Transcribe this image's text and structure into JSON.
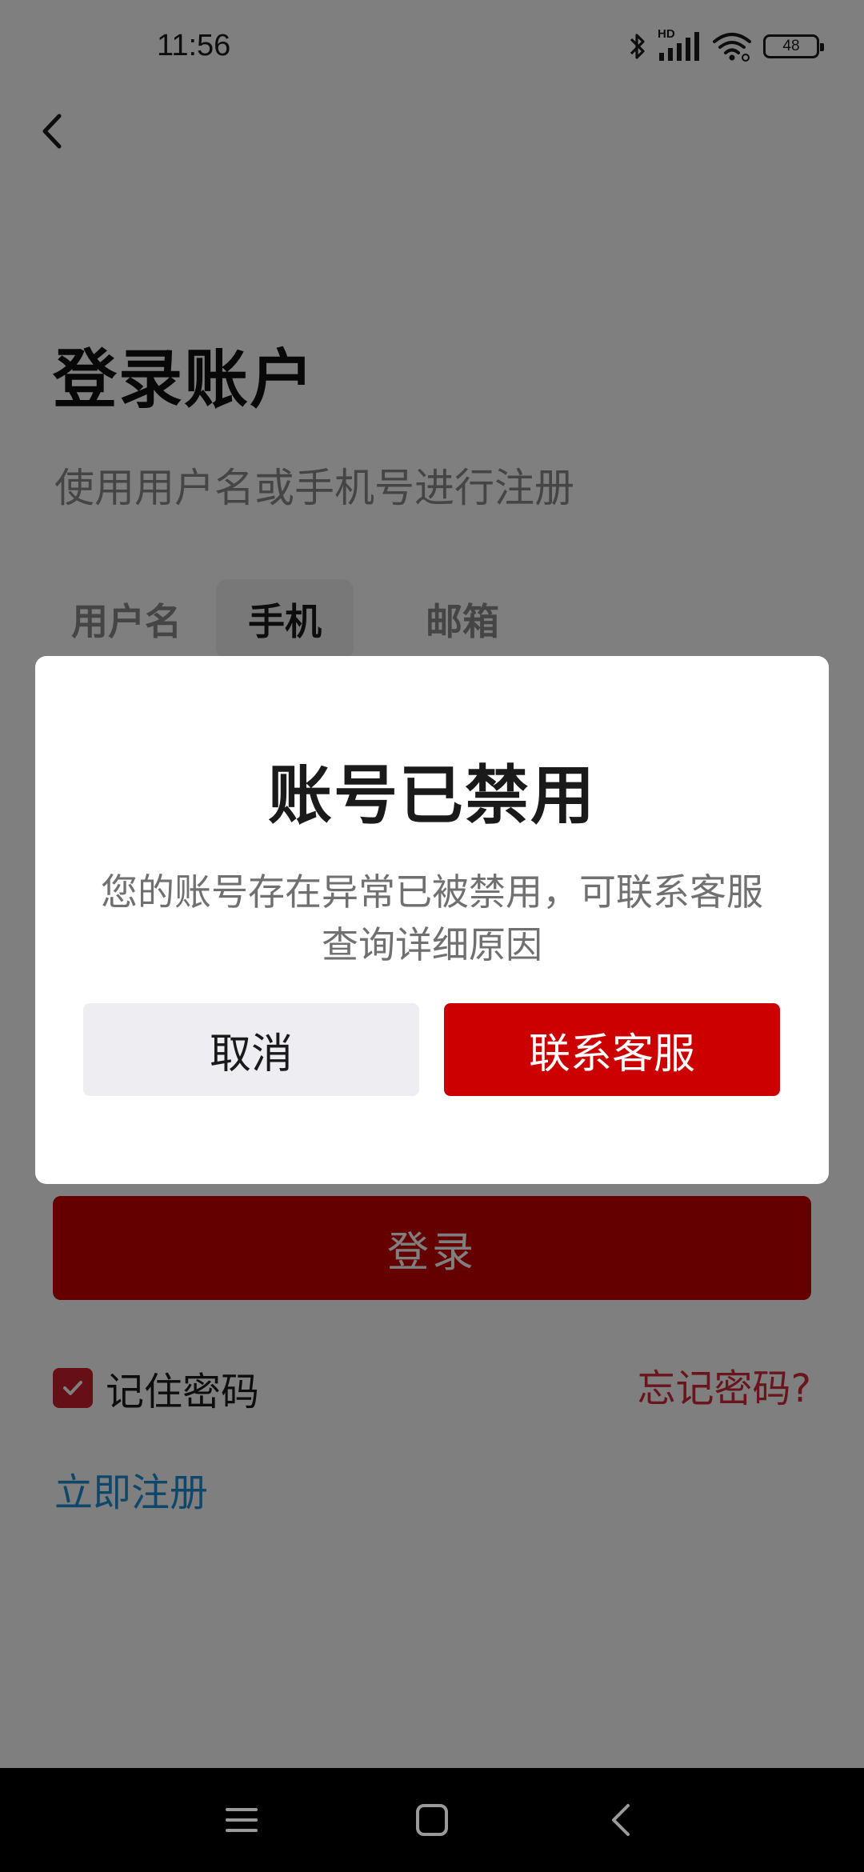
{
  "status_bar": {
    "time": "11:56",
    "network_label": "HD",
    "battery": "48",
    "icons": [
      "bluetooth-icon",
      "signal-icon",
      "wifi-icon",
      "battery-icon"
    ]
  },
  "header": {
    "back_icon": "chevron-left-icon"
  },
  "login": {
    "title": "登录账户",
    "subtitle": "使用用户名或手机号进行注册",
    "tabs": [
      {
        "label": "用户名",
        "selected": false
      },
      {
        "label": "手机",
        "selected": true
      },
      {
        "label": "邮箱",
        "selected": false
      }
    ],
    "login_button": "登录",
    "remember_label": "记住密码",
    "remember_checked": true,
    "forgot_link": "忘记密码?",
    "register_link": "立即注册"
  },
  "dialog": {
    "title": "账号已禁用",
    "message_line1": "您的账号存在异常已被禁用，可联系客服",
    "message_line2": "查询详细原因",
    "cancel_button": "取消",
    "contact_button": "联系客服"
  },
  "nav_bar": {
    "icons": [
      "menu-icon",
      "home-icon",
      "back-icon"
    ]
  },
  "colors": {
    "accent_red": "#cc0000",
    "link_blue": "#1f8fd6",
    "overlay": "rgba(0,0,0,0.5)"
  }
}
